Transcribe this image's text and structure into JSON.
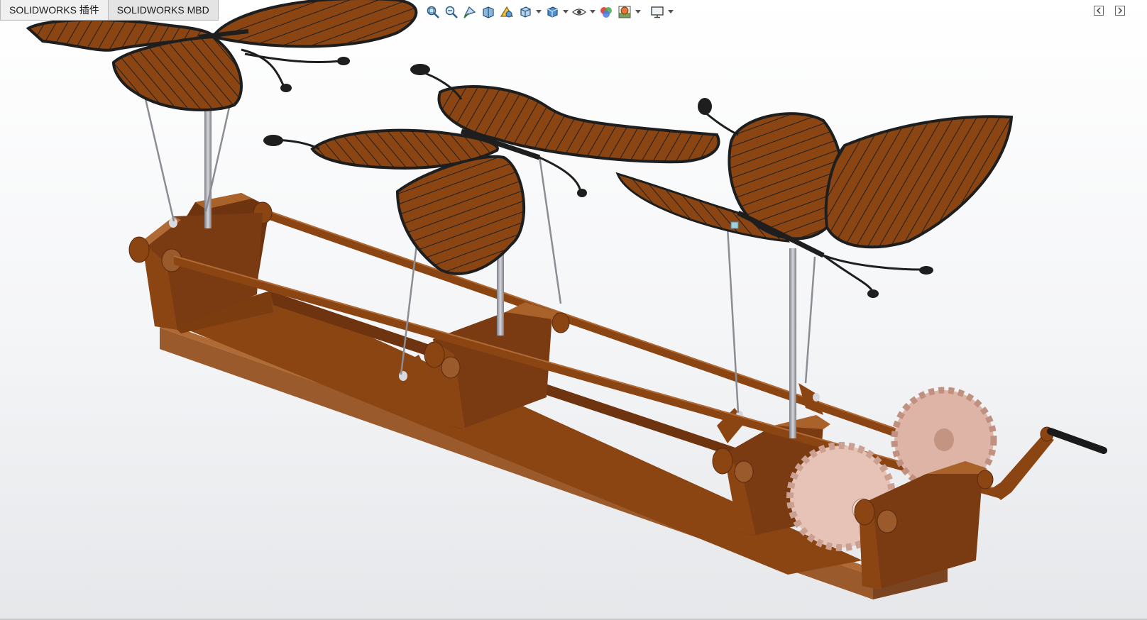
{
  "tabs": [
    {
      "label": "SOLIDWORKS 插件"
    },
    {
      "label": "SOLIDWORKS MBD"
    }
  ],
  "heads_up_toolbar": [
    {
      "icon": "zoom-to-fit-icon"
    },
    {
      "icon": "zoom-to-area-icon"
    },
    {
      "icon": "previous-view-icon"
    },
    {
      "icon": "section-view-icon"
    },
    {
      "icon": "dynamic-annotation-views-icon"
    },
    {
      "icon": "view-orientation-icon",
      "dropdown": true
    },
    {
      "icon": "display-style-icon",
      "dropdown": true
    },
    {
      "icon": "hide-show-items-icon",
      "dropdown": true
    },
    {
      "icon": "edit-appearance-icon"
    },
    {
      "icon": "apply-scene-icon",
      "dropdown": true
    },
    {
      "icon": "view-settings-icon",
      "dropdown": true
    }
  ],
  "window_controls": [
    {
      "icon": "collapse-panel-icon"
    },
    {
      "icon": "expand-panel-icon"
    }
  ],
  "colors": {
    "wood_dark": "#6e3410",
    "wood_mid": "#8a4513",
    "wood_light": "#a9622a",
    "wood_base": "#9b5a2c",
    "gear": "#ddb4a6",
    "rod": "#9a9aa2",
    "wing_outline": "#1e1e1e"
  }
}
